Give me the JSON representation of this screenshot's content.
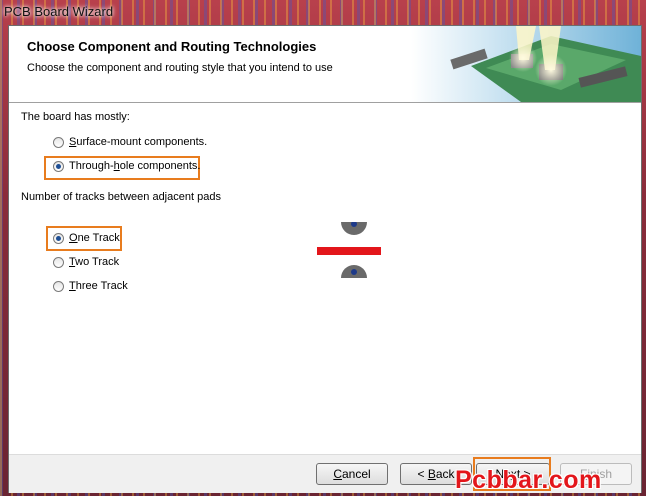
{
  "window": {
    "title": "PCB Board Wizard"
  },
  "header": {
    "title": "Choose Component and Routing Technologies",
    "subtitle": "Choose the component and routing style that you intend to use"
  },
  "component_group": {
    "label": "The board has mostly:",
    "options": [
      {
        "pre": "",
        "accel": "S",
        "post": "urface-mount components.",
        "selected": false
      },
      {
        "pre": "Through-",
        "accel": "h",
        "post": "ole components.",
        "selected": true
      }
    ]
  },
  "tracks_group": {
    "label": "Number of tracks between adjacent pads",
    "options": [
      {
        "pre": "",
        "accel": "O",
        "post": "ne Track",
        "selected": true
      },
      {
        "pre": "",
        "accel": "T",
        "post": "wo Track",
        "selected": false
      },
      {
        "pre": "",
        "accel": "T",
        "post": "hree Track",
        "selected": false
      }
    ]
  },
  "buttons": {
    "cancel": {
      "pre": "",
      "accel": "C",
      "post": "ancel"
    },
    "back": {
      "pre": "< ",
      "accel": "B",
      "post": "ack"
    },
    "next": {
      "pre": "Ne",
      "accel": "x",
      "post": "t >"
    },
    "finish": {
      "pre": "",
      "accel": "F",
      "post": "inish"
    }
  },
  "watermark": "Pcbbar.com",
  "colors": {
    "highlight": "#e87c1e",
    "track": "#e3161b",
    "radio_dot": "#1e4f95"
  }
}
